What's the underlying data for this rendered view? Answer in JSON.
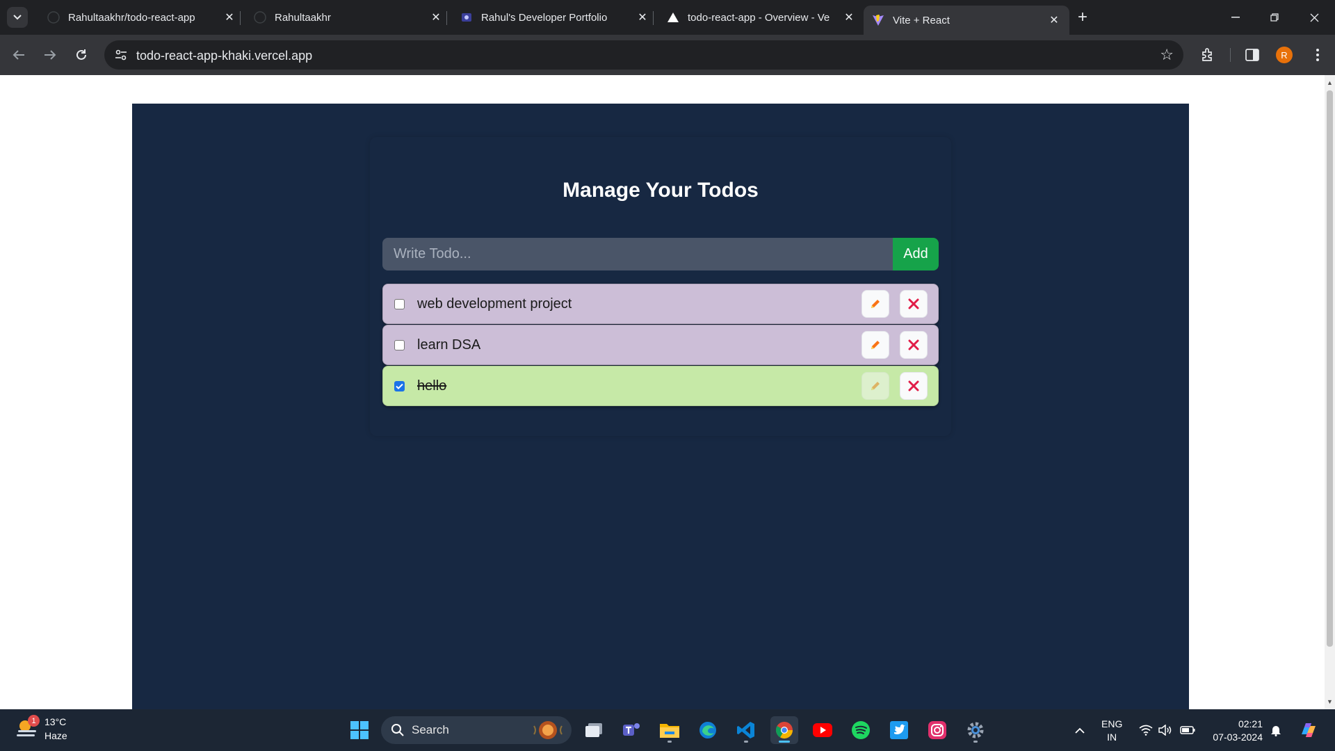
{
  "browser": {
    "tabs": [
      {
        "title": "Rahultaakhr/todo-react-app",
        "favicon": "github-icon"
      },
      {
        "title": "Rahultaakhr",
        "favicon": "github-icon"
      },
      {
        "title": "Rahul's Developer Portfolio",
        "favicon": "portfolio-icon"
      },
      {
        "title": "todo-react-app - Overview - Ve",
        "favicon": "vercel-icon"
      },
      {
        "title": "Vite + React",
        "favicon": "vite-icon",
        "active": true
      }
    ],
    "url": "todo-react-app-khaki.vercel.app",
    "profile_initial": "R"
  },
  "app": {
    "heading": "Manage Your Todos",
    "input_placeholder": "Write Todo...",
    "input_value": "",
    "add_label": "Add",
    "todos": [
      {
        "text": "web development project",
        "completed": false,
        "bg": "#ccbed7"
      },
      {
        "text": "learn DSA",
        "completed": false,
        "bg": "#ccbed7"
      },
      {
        "text": "hello",
        "completed": true,
        "bg": "#c6e9a7"
      }
    ],
    "colors": {
      "background": "#172842",
      "add_button": "#16a34a",
      "input": "#4a5568",
      "edit_icon": "#f97316",
      "delete_icon": "#e11d48"
    }
  },
  "taskbar": {
    "weather": {
      "temp": "13°C",
      "condition": "Haze",
      "badge": "1"
    },
    "search_label": "Search",
    "apps": [
      "windows-start-icon",
      "task-view-icon",
      "teams-icon",
      "file-explorer-icon",
      "edge-icon",
      "vscode-icon",
      "chrome-icon",
      "youtube-icon",
      "spotify-icon",
      "twitter-icon",
      "instagram-icon",
      "settings-icon"
    ],
    "language": "ENG",
    "region": "IN",
    "time": "02:21",
    "date": "07-03-2024"
  }
}
